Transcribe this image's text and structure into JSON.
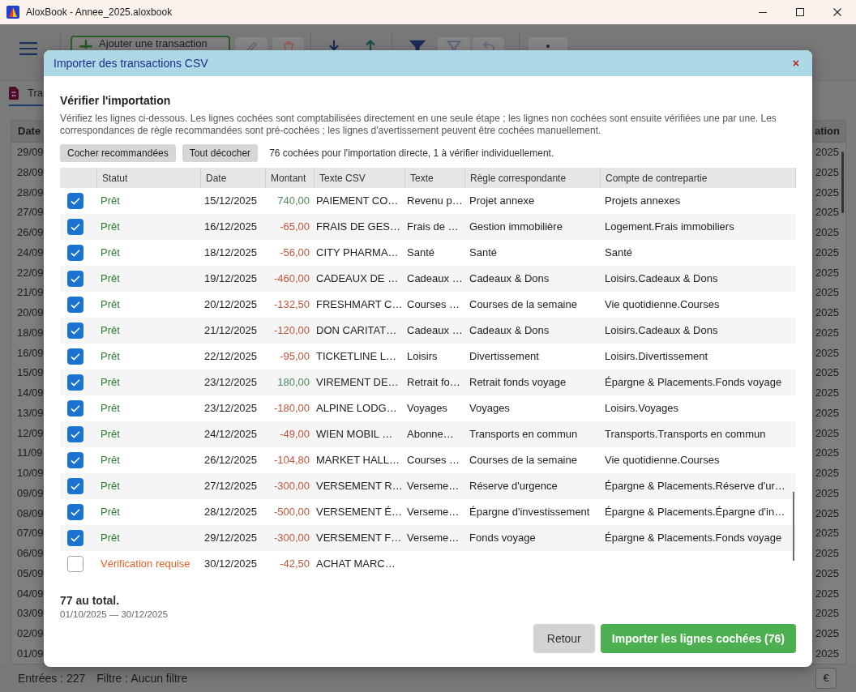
{
  "window": {
    "title": "AloxBook - Annee_2025.aloxbook"
  },
  "toolbar": {
    "add_button": "Ajouter une transaction"
  },
  "tabs": [
    {
      "label": "Tra",
      "selected": true
    }
  ],
  "background_table": {
    "columns": [
      "Date",
      "ation"
    ],
    "rows": [
      [
        "29/09",
        "2025"
      ],
      [
        "28/09",
        "2025"
      ],
      [
        "28/09",
        "2025"
      ],
      [
        "27/09",
        "2025"
      ],
      [
        "26/09",
        "2025"
      ],
      [
        "24/09",
        "2025"
      ],
      [
        "22/09",
        "2025"
      ],
      [
        "21/09",
        "2025"
      ],
      [
        "20/09",
        "2025"
      ],
      [
        "18/09",
        "2025"
      ],
      [
        "16/09",
        "2025"
      ],
      [
        "15/09",
        "2025"
      ],
      [
        "14/09",
        "2025"
      ],
      [
        "13/09",
        "2025"
      ],
      [
        "12/09",
        "2025"
      ],
      [
        "11/09",
        "2025"
      ],
      [
        "10/09",
        "2025"
      ],
      [
        "09/09",
        "2025"
      ],
      [
        "08/09",
        "2025"
      ],
      [
        "07/09",
        "2025"
      ],
      [
        "06/09",
        "2025"
      ],
      [
        "05/09",
        "2025"
      ],
      [
        "04/09",
        "2025"
      ],
      [
        "03/09",
        "2025"
      ],
      [
        "02/09",
        "2025"
      ],
      [
        "01/09",
        "2025"
      ]
    ]
  },
  "status_bar": {
    "entries": "Entrées : 227",
    "filter": "Filtre : Aucun filtre",
    "currency_button": "€"
  },
  "dialog": {
    "title": "Importer des transactions CSV",
    "close_button": "×",
    "heading": "Vérifier l'importation",
    "description": "Vérifiez les lignes ci-dessous. Les lignes cochées sont comptabilisées directement en une seule étape ; les lignes non cochées sont ensuite vérifiées une par une. Les correspondances de règle recommandées sont pré-cochées ; les lignes d'avertissement peuvent être cochées manuellement.",
    "buttons": [
      "Cocher recommandées",
      "Tout décocher"
    ],
    "summary": "76 cochées pour l'importation directe, 1 à vérifier individuellement.",
    "table": {
      "columns": [
        "Statut",
        "Date",
        "Montant",
        "Texte CSV",
        "Texte",
        "Règle correspondante",
        "Compte de contrepartie"
      ],
      "rows": [
        {
          "checked": true,
          "needs_review": false,
          "status": "Prêt",
          "date": "15/12/2025",
          "amount": "740,00",
          "incoming": true,
          "csv_text": "PAIEMENT CO…",
          "text": "Revenu p…",
          "rule": "Projet annexe",
          "account": "Projets annexes"
        },
        {
          "checked": true,
          "needs_review": false,
          "status": "Prêt",
          "date": "16/12/2025",
          "amount": "-65,00",
          "incoming": false,
          "csv_text": "FRAIS DE GES…",
          "text": "Frais de …",
          "rule": "Gestion immobilière",
          "account": "Logement.Frais immobiliers"
        },
        {
          "checked": true,
          "needs_review": false,
          "status": "Prêt",
          "date": "18/12/2025",
          "amount": "-56,00",
          "incoming": false,
          "csv_text": "CITY PHARMA…",
          "text": "Santé",
          "rule": "Santé",
          "account": "Santé"
        },
        {
          "checked": true,
          "needs_review": false,
          "status": "Prêt",
          "date": "19/12/2025",
          "amount": "-460,00",
          "incoming": false,
          "csv_text": "CADEAUX DE …",
          "text": "Cadeaux …",
          "rule": "Cadeaux & Dons",
          "account": "Loisirs.Cadeaux & Dons"
        },
        {
          "checked": true,
          "needs_review": false,
          "status": "Prêt",
          "date": "20/12/2025",
          "amount": "-132,50",
          "incoming": false,
          "csv_text": "FRESHMART C…",
          "text": "Courses …",
          "rule": "Courses de la semaine",
          "account": "Vie quotidienne.Courses"
        },
        {
          "checked": true,
          "needs_review": false,
          "status": "Prêt",
          "date": "21/12/2025",
          "amount": "-120,00",
          "incoming": false,
          "csv_text": "DON CARITAT…",
          "text": "Cadeaux …",
          "rule": "Cadeaux & Dons",
          "account": "Loisirs.Cadeaux & Dons"
        },
        {
          "checked": true,
          "needs_review": false,
          "status": "Prêt",
          "date": "22/12/2025",
          "amount": "-95,00",
          "incoming": false,
          "csv_text": "TICKETLINE L…",
          "text": "Loisirs",
          "rule": "Divertissement",
          "account": "Loisirs.Divertissement"
        },
        {
          "checked": true,
          "needs_review": false,
          "status": "Prêt",
          "date": "23/12/2025",
          "amount": "180,00",
          "incoming": true,
          "csv_text": "VIREMENT DE…",
          "text": "Retrait fo…",
          "rule": "Retrait fonds voyage",
          "account": "Épargne & Placements.Fonds voyage"
        },
        {
          "checked": true,
          "needs_review": false,
          "status": "Prêt",
          "date": "23/12/2025",
          "amount": "-180,00",
          "incoming": false,
          "csv_text": "ALPINE LODG…",
          "text": "Voyages",
          "rule": "Voyages",
          "account": "Loisirs.Voyages"
        },
        {
          "checked": true,
          "needs_review": false,
          "status": "Prêt",
          "date": "24/12/2025",
          "amount": "-49,00",
          "incoming": false,
          "csv_text": "WIEN MOBIL …",
          "text": "Abonne…",
          "rule": "Transports en commun",
          "account": "Transports.Transports en commun"
        },
        {
          "checked": true,
          "needs_review": false,
          "status": "Prêt",
          "date": "26/12/2025",
          "amount": "-104,80",
          "incoming": false,
          "csv_text": "MARKET HALL…",
          "text": "Courses …",
          "rule": "Courses de la semaine",
          "account": "Vie quotidienne.Courses"
        },
        {
          "checked": true,
          "needs_review": false,
          "status": "Prêt",
          "date": "27/12/2025",
          "amount": "-300,00",
          "incoming": false,
          "csv_text": "VERSEMENT R…",
          "text": "Verseme…",
          "rule": "Réserve d'urgence",
          "account": "Épargne & Placements.Réserve d'ur…"
        },
        {
          "checked": true,
          "needs_review": false,
          "status": "Prêt",
          "date": "28/12/2025",
          "amount": "-500,00",
          "incoming": false,
          "csv_text": "VERSEMENT É…",
          "text": "Verseme…",
          "rule": "Épargne d'investissement",
          "account": "Épargne & Placements.Épargne d'in…"
        },
        {
          "checked": true,
          "needs_review": false,
          "status": "Prêt",
          "date": "29/12/2025",
          "amount": "-300,00",
          "incoming": false,
          "csv_text": "VERSEMENT F…",
          "text": "Verseme…",
          "rule": "Fonds voyage",
          "account": "Épargne & Placements.Fonds voyage"
        },
        {
          "checked": false,
          "needs_review": true,
          "status": "Vérification requise",
          "date": "30/12/2025",
          "amount": "-42,50",
          "incoming": false,
          "csv_text": "ACHAT MARC…"
        }
      ]
    },
    "total": "77 au total.",
    "date_range": "01/10/2025 — 30/12/2025",
    "back_button": "Retour",
    "import_button": "Importer les lignes cochées (76)"
  }
}
